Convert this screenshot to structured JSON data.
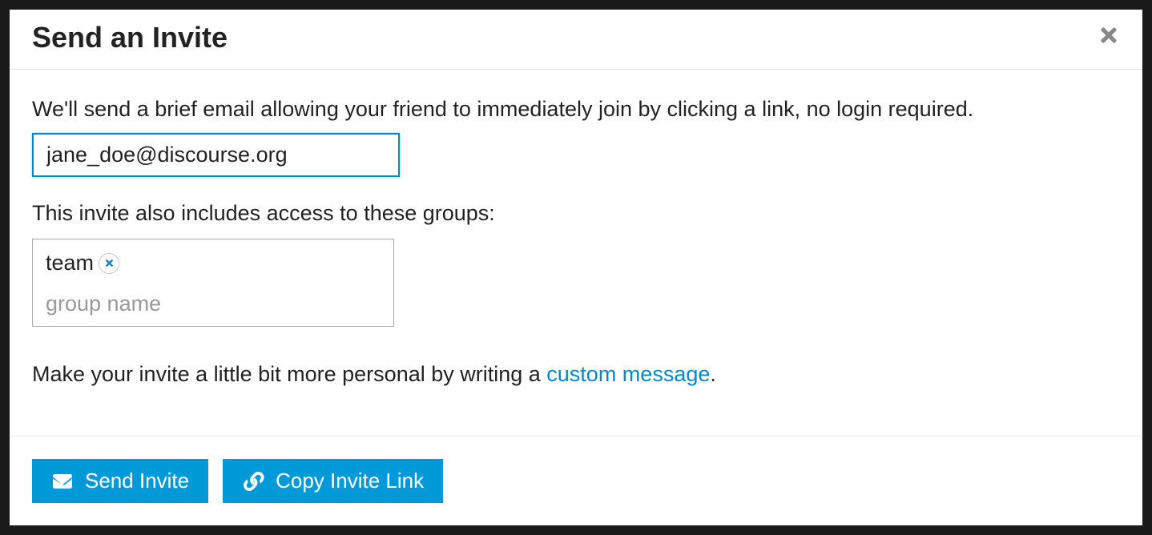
{
  "modal": {
    "title": "Send an Invite",
    "description": "We'll send a brief email allowing your friend to immediately join by clicking a link, no login required.",
    "email_value": "jane_doe@discourse.org",
    "groups_label": "This invite also includes access to these groups:",
    "group_tag": "team",
    "group_placeholder": "group name",
    "personal_prefix": "Make your invite a little bit more personal by writing a ",
    "custom_message_link": "custom message",
    "personal_suffix": "."
  },
  "footer": {
    "send_label": "Send Invite",
    "copy_label": "Copy Invite Link"
  }
}
